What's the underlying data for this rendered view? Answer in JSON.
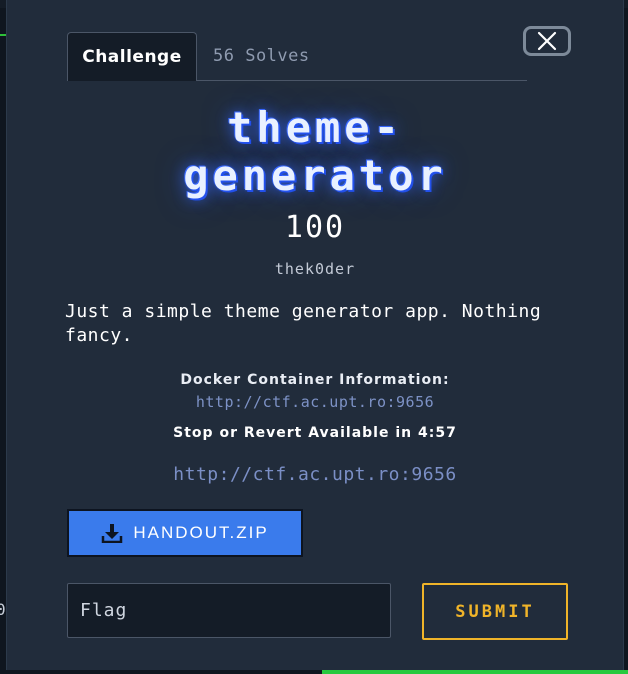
{
  "modal": {
    "tabs": [
      {
        "label": "Challenge",
        "active": true
      },
      {
        "label": "56 Solves",
        "active": false
      }
    ],
    "title_line1": "theme-",
    "title_line2": "generator",
    "value": "100",
    "author": "thek0der",
    "description": "Just a simple theme generator app. Nothing fancy.",
    "docker": {
      "heading": "Docker Container Information:",
      "url": "http://ctf.ac.upt.ro:9656",
      "stop_revert": "Stop or Revert Available in 4:57"
    },
    "link": "http://ctf.ac.upt.ro:9656",
    "handout_label": "HANDOUT.ZIP",
    "flag_placeholder": "Flag",
    "submit_label": "SUBMIT"
  },
  "background": {
    "partial_digit": "0"
  },
  "colors": {
    "accent_blue": "#3a7bec",
    "submit_gold": "#f0b429",
    "modal_bg": "#212c3b",
    "link": "#7b8fc6"
  },
  "icons": {
    "close": "close-icon",
    "download": "download-icon"
  }
}
